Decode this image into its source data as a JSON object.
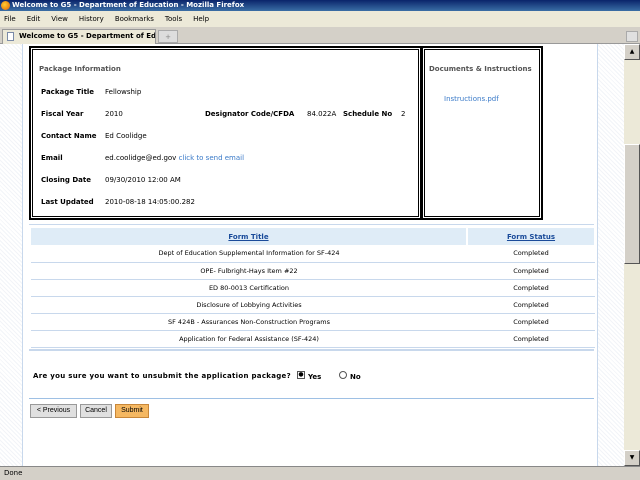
{
  "window": {
    "title": "Welcome to G5 - Department of Education - Mozilla Firefox"
  },
  "menu": [
    "File",
    "Edit",
    "View",
    "History",
    "Bookmarks",
    "Tools",
    "Help"
  ],
  "tab": {
    "label": "Welcome to G5 - Department of Edu...",
    "new_tab": "+"
  },
  "package": {
    "heading": "Package Information",
    "title_label": "Package Title",
    "title": "Fellowship",
    "fy_label": "Fiscal Year",
    "fy": "2010",
    "cfda_label": "Designator Code/CFDA",
    "cfda": "84.022A",
    "sched_label": "Schedule No",
    "sched": "2",
    "contact_label": "Contact Name",
    "contact": "Ed Coolidge",
    "email_label": "Email",
    "email": "ed.coolidge@ed.gov",
    "email_link": "click to send email",
    "closing_label": "Closing Date",
    "closing": "09/30/2010 12:00 AM",
    "updated_label": "Last Updated",
    "updated": "2010-08-18 14:05:00.282"
  },
  "docs": {
    "heading": "Documents & Instructions",
    "file": "Instructions.pdf"
  },
  "forms": {
    "headers": [
      "Form Title",
      "Form Status"
    ],
    "rows": [
      [
        "Dept of Education Supplemental Information for SF-424",
        "Completed"
      ],
      [
        "OPE- Fulbright-Hays Item #22",
        "Completed"
      ],
      [
        "ED 80-0013 Certification",
        "Completed"
      ],
      [
        "Disclosure of Lobbying Activities",
        "Completed"
      ],
      [
        "SF 424B - Assurances Non-Construction Programs",
        "Completed"
      ],
      [
        "Application for Federal Assistance (SF-424)",
        "Completed"
      ]
    ]
  },
  "confirm": {
    "question": "Are you sure you want to unsubmit the application package?",
    "yes": "Yes",
    "no": "No",
    "selected": "Yes"
  },
  "buttons": {
    "previous": "< Previous",
    "cancel": "Cancel",
    "submit": "Submit"
  },
  "status": "Done",
  "colors": {
    "link": "#3a7ac8",
    "header_bg": "#dfecf7",
    "submit": "#f5b862"
  }
}
